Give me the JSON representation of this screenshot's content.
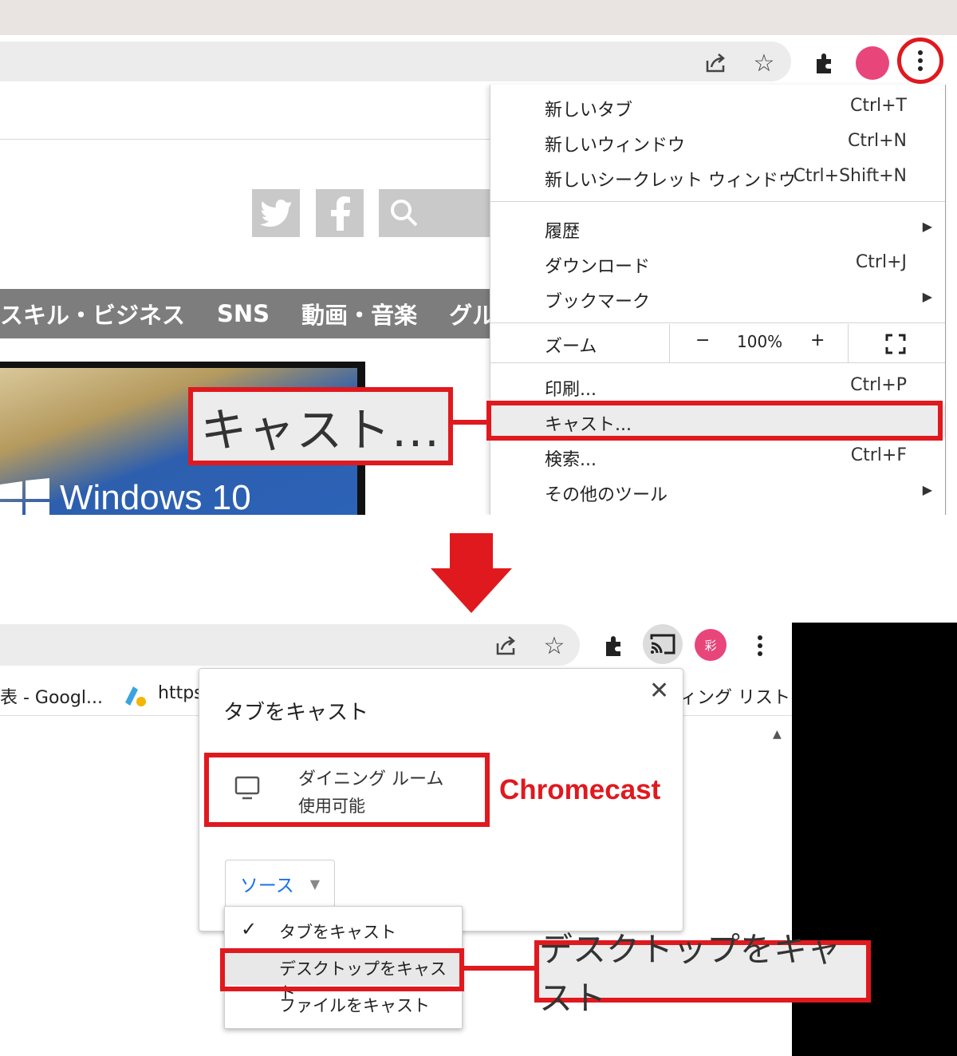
{
  "top": {
    "menu_items": {
      "new_tab": {
        "label": "新しいタブ",
        "shortcut": "Ctrl+T"
      },
      "new_window": {
        "label": "新しいウィンドウ",
        "shortcut": "Ctrl+N"
      },
      "incognito": {
        "label": "新しいシークレット ウィンドウ",
        "shortcut": "Ctrl+Shift+N"
      },
      "history": {
        "label": "履歴"
      },
      "downloads": {
        "label": "ダウンロード",
        "shortcut": "Ctrl+J"
      },
      "bookmarks": {
        "label": "ブックマーク"
      },
      "zoom": {
        "label": "ズーム",
        "minus": "−",
        "value": "100%",
        "plus": "+"
      },
      "print": {
        "label": "印刷...",
        "shortcut": "Ctrl+P"
      },
      "cast": {
        "label": "キャスト..."
      },
      "search": {
        "label": "検索...",
        "shortcut": "Ctrl+F"
      },
      "more_tools": {
        "label": "その他のツール"
      }
    },
    "site_nav": [
      "スキル・ビジネス",
      "SNS",
      "動画・音楽",
      "グル"
    ],
    "article_image_text": "Windows 10",
    "callout": "キャスト..."
  },
  "bottom": {
    "bookmarks": {
      "item1": "表 - Googl...",
      "item2": "https",
      "item3": "ィング リスト"
    },
    "dialog": {
      "title": "タブをキャスト",
      "device_name": "ダイニング ルーム",
      "device_status": "使用可能",
      "source_label": "ソース"
    },
    "dropdown": {
      "cast_tab": "タブをキャスト",
      "cast_desktop": "デスクトップをキャスト",
      "cast_file": "ファイルをキャスト"
    },
    "annotation_chromecast": "Chromecast",
    "callout": "デスクトップをキャスト",
    "avatar_char": "彩"
  },
  "colors": {
    "highlight": "#e0191f",
    "avatar": "#e8457b",
    "link_blue": "#1a73e8"
  }
}
